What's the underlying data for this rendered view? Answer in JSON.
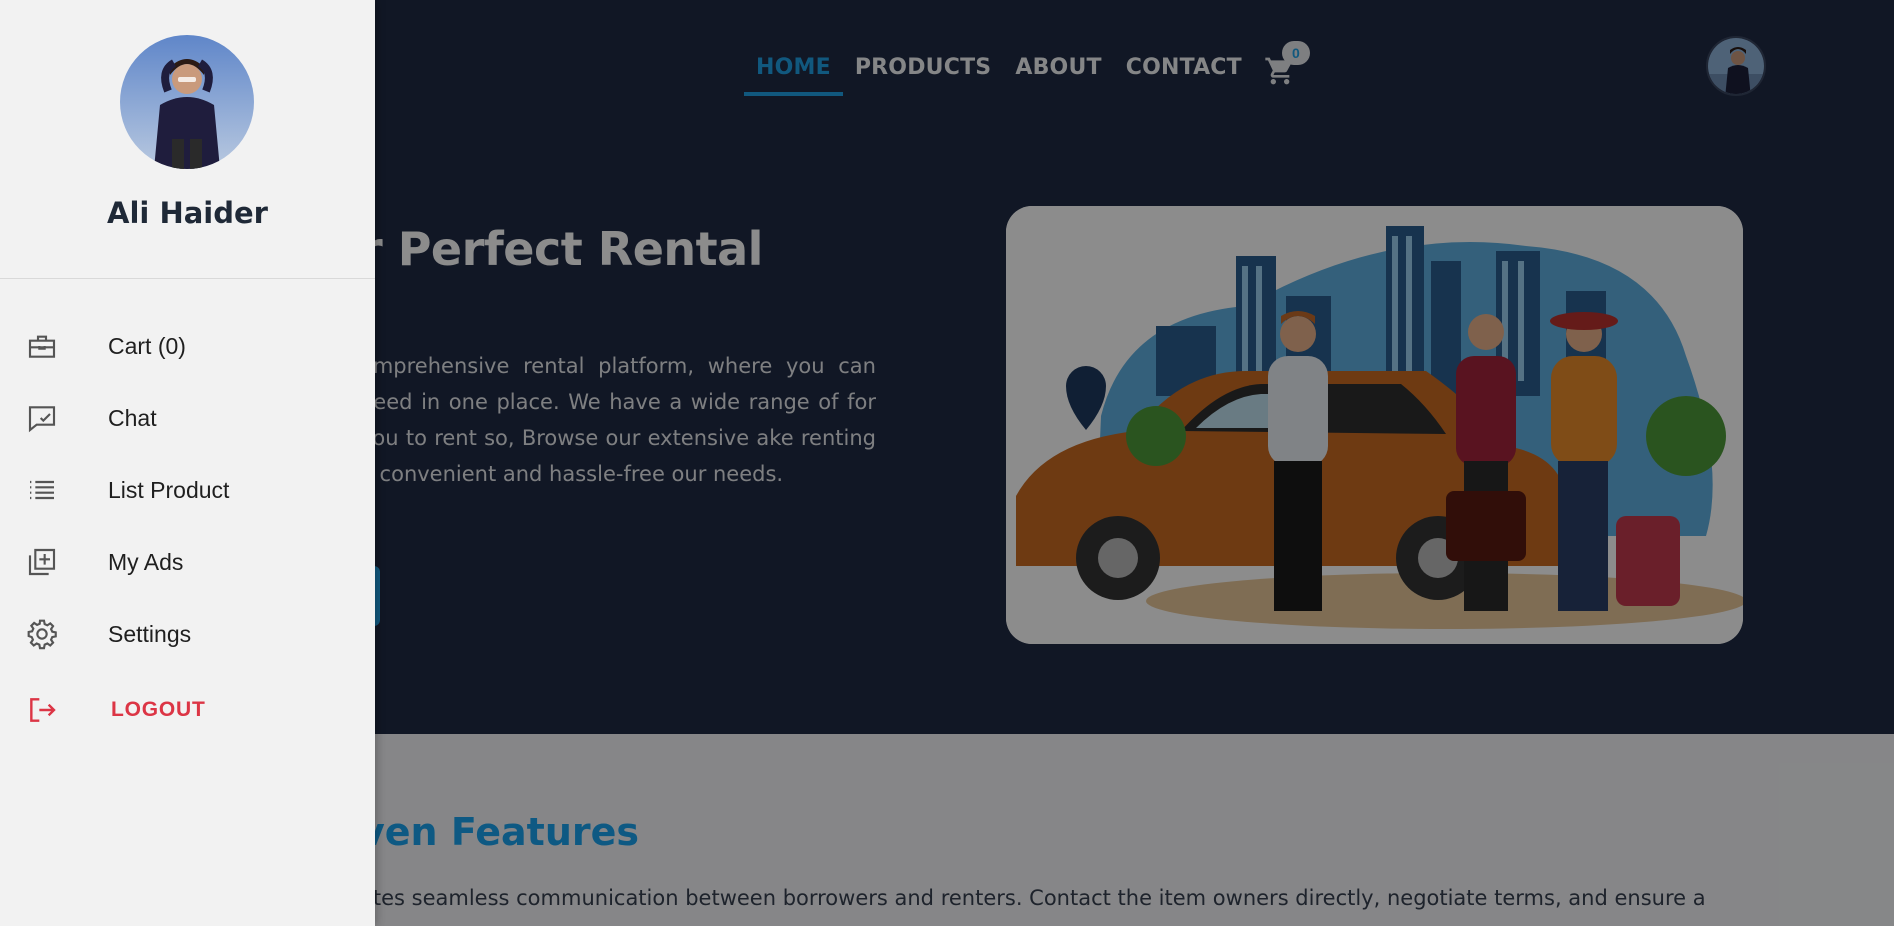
{
  "nav": {
    "links": [
      "HOME",
      "PRODUCTS",
      "ABOUT",
      "CONTACT"
    ],
    "active": "HOME",
    "cart_count": "0"
  },
  "hero": {
    "title_visible": "r Perfect Rental",
    "text_visible": "omprehensive rental platform, where you can need in one place. We have a wide range of for you to rent so, Browse our extensive ake renting a convenient and hassle-free our needs."
  },
  "features": {
    "title_visible": "ven Features",
    "text_visible": "ates seamless communication between borrowers and renters. Contact the item owners directly, negotiate terms, and ensure a"
  },
  "drawer": {
    "user_name": "Ali Haider",
    "menu": [
      {
        "label": "Cart (0)",
        "icon": "briefcase-icon"
      },
      {
        "label": "Chat",
        "icon": "chat-check-icon"
      },
      {
        "label": "List Product",
        "icon": "list-icon"
      },
      {
        "label": "My Ads",
        "icon": "add-library-icon"
      },
      {
        "label": "Settings",
        "icon": "gear-icon"
      },
      {
        "label": "LOGOUT",
        "icon": "logout-icon"
      }
    ]
  },
  "colors": {
    "hero_bg": "#1f2a44",
    "accent": "#1fa0e6",
    "drawer_bg": "#f2f2f2",
    "logout": "#dc3545"
  }
}
